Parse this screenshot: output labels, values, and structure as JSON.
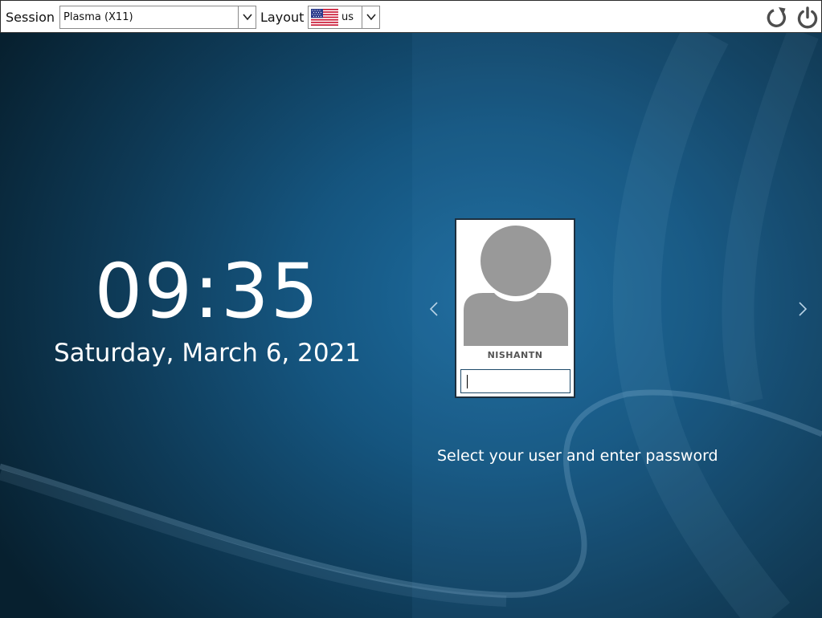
{
  "topbar": {
    "session_label": "Session",
    "session_value": "Plasma (X11)",
    "layout_label": "Layout",
    "layout_value": "us",
    "layout_flag_icon": "us-flag-icon",
    "reboot_icon": "reboot-icon",
    "shutdown_icon": "power-icon"
  },
  "clock": {
    "time": "09:35",
    "date": "Saturday, March 6, 2021"
  },
  "login": {
    "username": "NISHANTN",
    "password_value": "",
    "prev_icon": "chevron-left-icon",
    "next_icon": "chevron-right-icon",
    "hint": "Select your user and enter password"
  },
  "colors": {
    "background_center": "#1d6c9f",
    "background_edge": "#07202f",
    "avatar_gray": "#999999",
    "card_border": "#1d2f3e"
  }
}
